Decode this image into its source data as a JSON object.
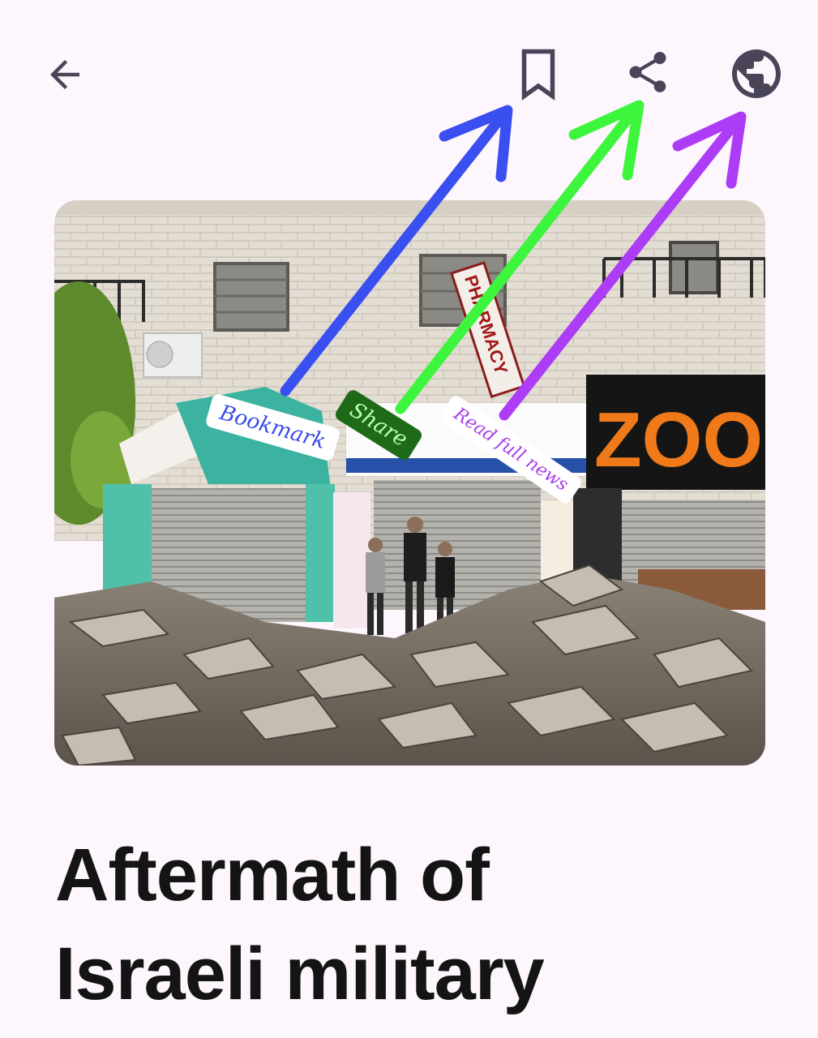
{
  "toolbar": {
    "back_icon": "arrow-left-icon",
    "bookmark_icon": "bookmark-icon",
    "share_icon": "share-icon",
    "globe_icon": "globe-icon"
  },
  "annotations": {
    "bookmark_label": "Bookmark",
    "share_label": "Share",
    "read_label": "Read full news"
  },
  "photo": {
    "pharmacy_sign": "PHARMACY",
    "zoo_sign": "ZOO"
  },
  "article": {
    "headline_line1": "Aftermath of",
    "headline_line2": "Israeli military"
  },
  "colors": {
    "background": "#fdf6fd",
    "icon": "#4a4458",
    "bookmark_arrow": "#3a4ff0",
    "share_arrow": "#3cf53c",
    "read_arrow": "#ad3cf6"
  }
}
